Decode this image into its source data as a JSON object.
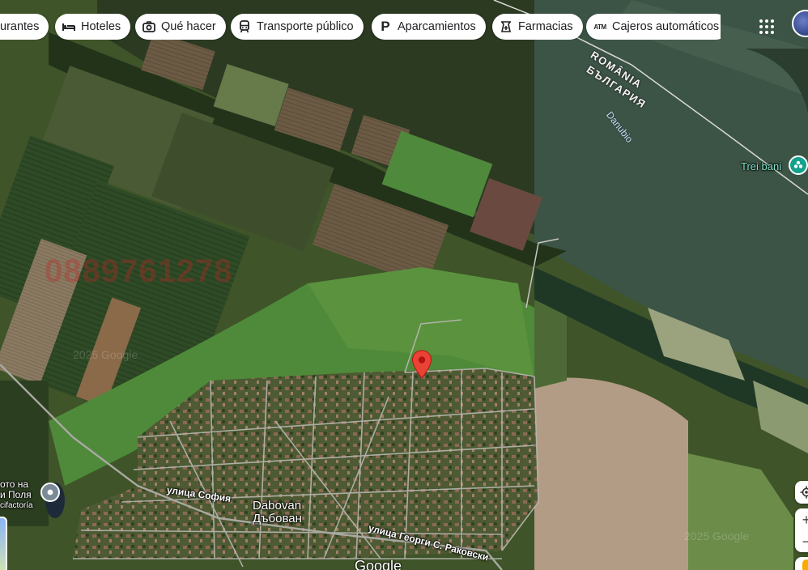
{
  "chips": [
    {
      "label": "urantes",
      "icon": "restaurant-icon"
    },
    {
      "label": "Hoteles",
      "icon": "bed-icon"
    },
    {
      "label": "Qué hacer",
      "icon": "camera-icon"
    },
    {
      "label": "Transporte público",
      "icon": "train-icon"
    },
    {
      "label": "Aparcamientos",
      "icon": "parking-icon"
    },
    {
      "label": "Farmacias",
      "icon": "pharmacy-icon"
    },
    {
      "label": "Cajeros automáticos",
      "icon": "atm-icon"
    }
  ],
  "border": {
    "country_north": "ROMÂNIA",
    "country_south": "БЪЛГАРИЯ"
  },
  "labels": {
    "river": "Danubio",
    "trei_bani": "Trei bani",
    "village_latin": "Dabovan",
    "village_cyrillic": "Дъбован",
    "street_sofia": "улица София",
    "street_rakovski": "улица Георги С. Раковски",
    "poi_line1": "ото на",
    "poi_line2": "и Поля",
    "poi_line3": "cifactoría",
    "watermark_phone": "0889761278",
    "watermark_copy_left": "2025 Google",
    "watermark_copy_right": "2025 Google",
    "google_logo": "Google"
  },
  "colors": {
    "pin_red": "#ea4335",
    "trei_green": "#12a28c"
  }
}
